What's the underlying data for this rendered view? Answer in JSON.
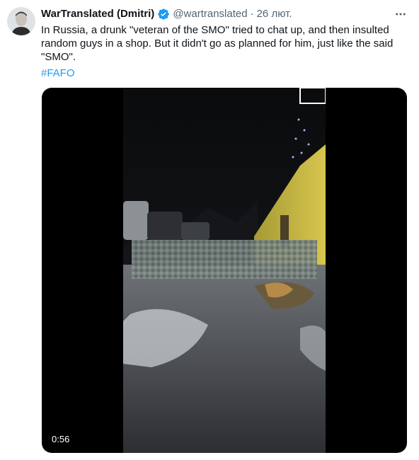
{
  "tweet": {
    "display_name": "WarTranslated (Dmitri)",
    "handle": "@wartranslated",
    "separator": "·",
    "time": "26 лют.",
    "text": "In Russia, a drunk \"veteran of the SMO\" tried to chat up, and then insulted random guys in a shop. But it didn't go as planned for him, just like the said \"SMO\".",
    "hashtag": "#FAFO"
  },
  "media": {
    "type": "video",
    "duration": "0:56"
  },
  "icons": {
    "verified": "verified-badge-icon",
    "more": "more-options-icon"
  },
  "colors": {
    "accent": "#1d9bf0",
    "text": "#0f1419",
    "secondary": "#536471"
  }
}
